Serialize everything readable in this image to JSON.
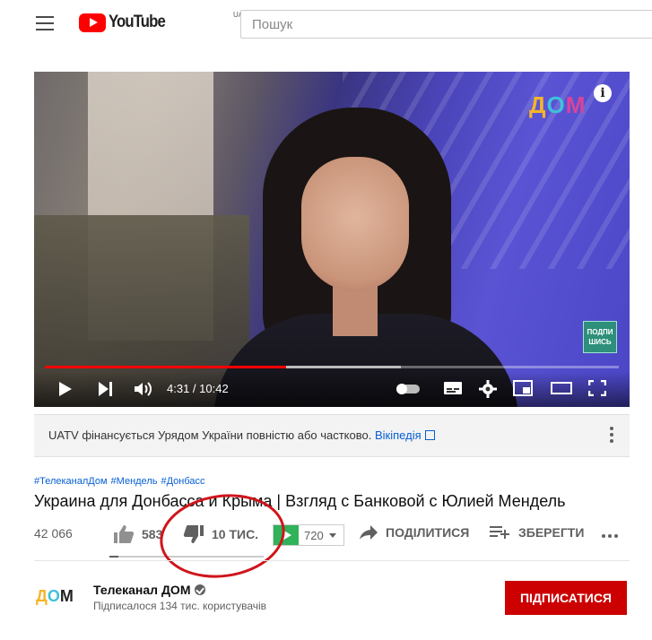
{
  "masthead": {
    "logo_text": "YouTube",
    "region": "UA",
    "search_placeholder": "Пошук"
  },
  "player": {
    "channel_watermark": {
      "d": "Д",
      "o": "O",
      "m": "M"
    },
    "info_icon": "i",
    "subscribe_badge_line1": "ПОДПИ",
    "subscribe_badge_line2": "ШИСЬ",
    "time": "4:31 / 10:42",
    "progress_played_fraction": 0.42,
    "icons": [
      "play-icon",
      "next-icon",
      "volume-icon",
      "autoplay-toggle-icon",
      "subtitles-icon",
      "settings-icon",
      "miniplayer-icon",
      "theater-icon",
      "fullscreen-icon"
    ]
  },
  "info_panel": {
    "text": "UATV фінансується Урядом України повністю або частково.",
    "link": "Вікіпедія"
  },
  "video": {
    "hashtags": [
      "#ТелеканалДом",
      "#Мендель",
      "#Донбасс"
    ],
    "title": "Украина для Донбасса и Крыма | Взгляд с Банковой с Юлией Мендель",
    "views": "42 066",
    "likes": "583",
    "dislikes": "10 ТИС.",
    "like_fraction": 0.06,
    "extension_value": "720",
    "share_label": "ПОДІЛИТИСЯ",
    "save_label": "ЗБЕРЕГТИ"
  },
  "channel": {
    "logo": {
      "d": "Д",
      "o": "O",
      "m": "M"
    },
    "name": "Телеканал ДОМ",
    "subscribers": "Підписалося 134 тис. користувачів",
    "subscribe_label": "ПІДПИСАТИСЯ"
  },
  "colors": {
    "accent_red": "#ff0000",
    "subscribe_red": "#cc0000",
    "link_blue": "#065fd4",
    "annotation_red": "#d0141c"
  }
}
